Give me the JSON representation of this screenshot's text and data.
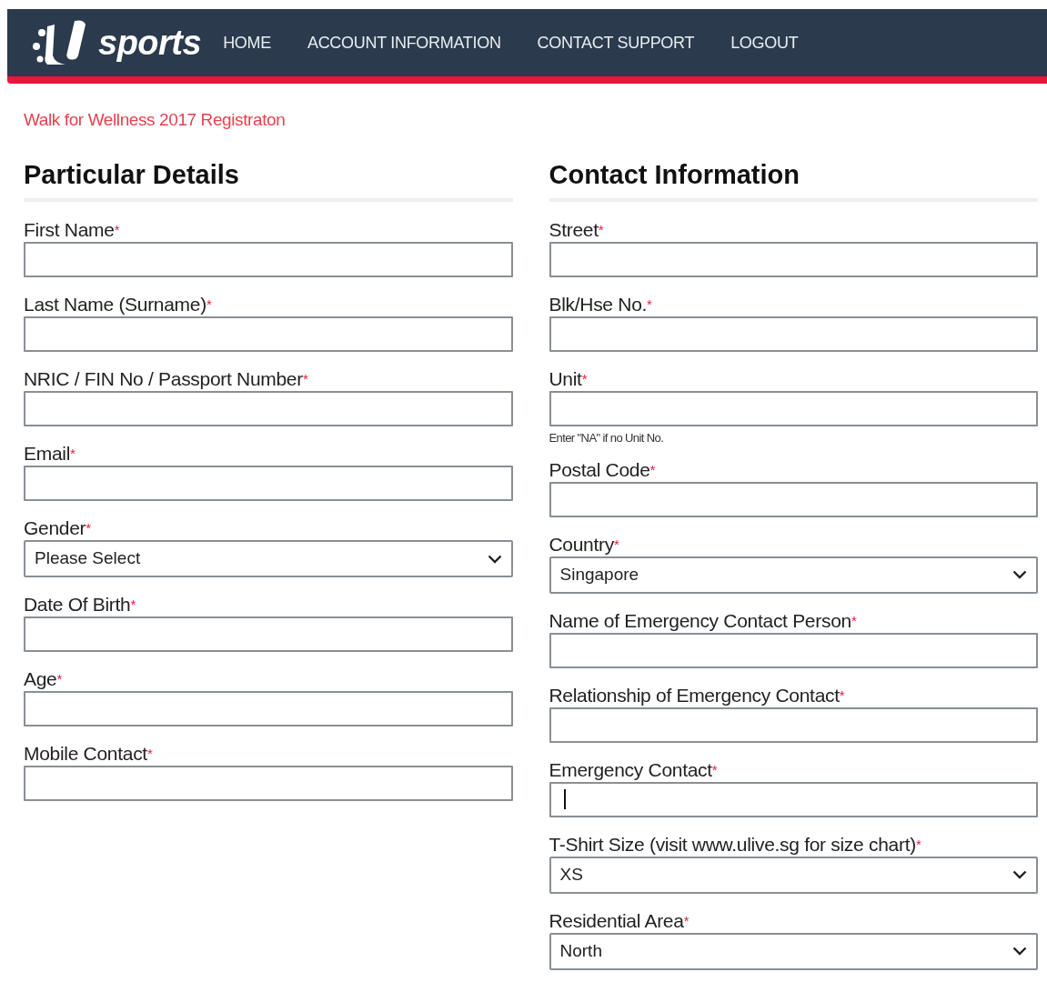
{
  "brand": {
    "name": "sports"
  },
  "nav": [
    {
      "label": "HOME"
    },
    {
      "label": "ACCOUNT INFORMATION"
    },
    {
      "label": "CONTACT SUPPORT"
    },
    {
      "label": "LOGOUT"
    }
  ],
  "page_title": "Walk for Wellness 2017 Registraton",
  "columns": [
    {
      "heading": "Particular Details",
      "fields": [
        {
          "label": "First Name",
          "marker": "*",
          "kind": "text"
        },
        {
          "label": "Last Name (Surname)",
          "marker": "*",
          "kind": "text"
        },
        {
          "label": "NRIC / FIN No / Passport Number",
          "marker": "*",
          "kind": "text"
        },
        {
          "label": "Email",
          "marker": "*",
          "kind": "text"
        },
        {
          "label": "Gender",
          "marker": "*",
          "kind": "select",
          "value": "Please Select"
        },
        {
          "label": "Date Of Birth",
          "marker": "*",
          "kind": "text"
        },
        {
          "label": "Age",
          "marker": "*",
          "kind": "text"
        },
        {
          "label": "Mobile Contact",
          "marker": "*",
          "kind": "text"
        }
      ]
    },
    {
      "heading": "Contact Information",
      "fields": [
        {
          "label": "Street",
          "marker": "*",
          "kind": "text"
        },
        {
          "label": "Blk/Hse No.",
          "marker": "*",
          "kind": "text"
        },
        {
          "label": "Unit",
          "marker": "*",
          "kind": "text",
          "help": "Enter \"NA\" if no Unit No."
        },
        {
          "label": "Postal Code",
          "marker": "*",
          "kind": "text"
        },
        {
          "label": "Country",
          "marker": "*",
          "kind": "select",
          "value": "Singapore"
        },
        {
          "label": "Name of Emergency Contact Person",
          "marker": "*",
          "kind": "text"
        },
        {
          "label": "Relationship of Emergency Contact",
          "marker": "*",
          "kind": "text"
        },
        {
          "label": "Emergency Contact",
          "marker": "*",
          "kind": "text",
          "focused": true
        },
        {
          "label": "T-Shirt Size (visit www.ulive.sg for size chart)",
          "marker": "*",
          "kind": "select",
          "value": "XS"
        },
        {
          "label": "Residential Area",
          "marker": "*",
          "kind": "select",
          "value": "North"
        }
      ]
    }
  ]
}
